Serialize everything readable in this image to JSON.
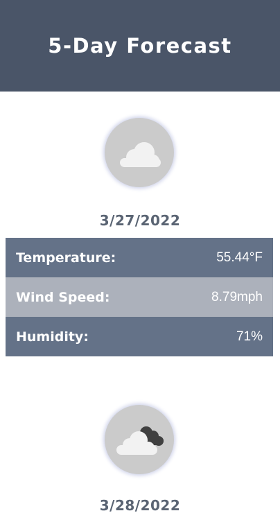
{
  "header": {
    "title": "5-Day Forecast"
  },
  "days": [
    {
      "icon": "cloud-icon",
      "date": "3/27/2022",
      "temperature_label": "Temperature:",
      "temperature_value": "55.44°F",
      "wind_label": "Wind Speed:",
      "wind_value": "8.79mph",
      "humidity_label": "Humidity:",
      "humidity_value": "71%"
    },
    {
      "icon": "broken-clouds-icon",
      "date": "3/28/2022"
    }
  ],
  "colors": {
    "header_bg": "#4a5568",
    "row_dark": "#647288",
    "row_light": "#acb1bb",
    "date_text": "#5a6473",
    "icon_circle": "#cbcbcb"
  }
}
